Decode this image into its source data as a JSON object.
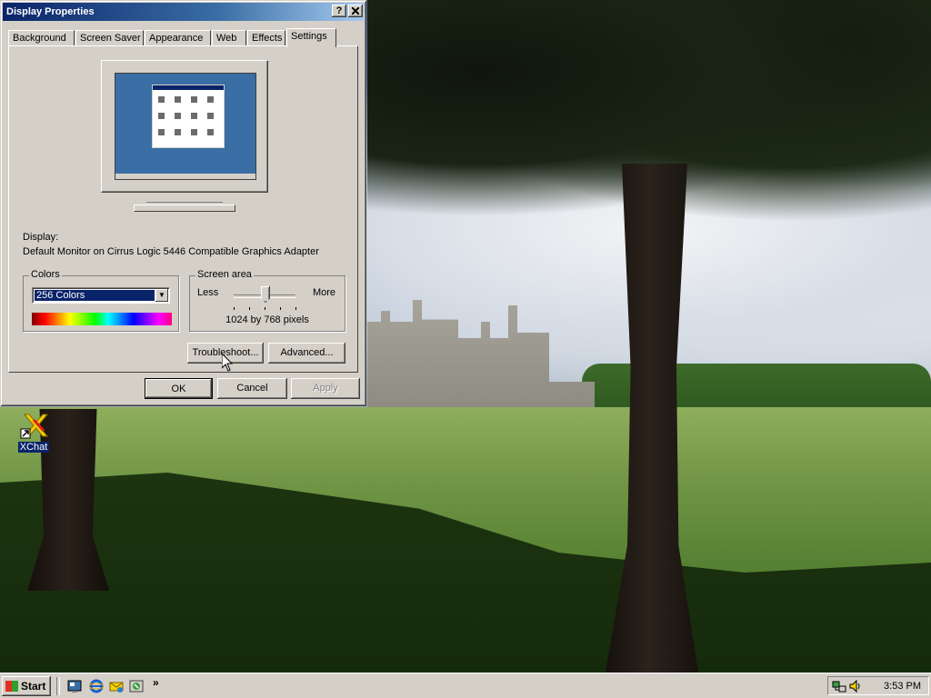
{
  "window": {
    "title": "Display Properties",
    "help_button": "?",
    "close_button": "✕"
  },
  "tabs": [
    {
      "label": "Background"
    },
    {
      "label": "Screen Saver"
    },
    {
      "label": "Appearance"
    },
    {
      "label": "Web"
    },
    {
      "label": "Effects"
    },
    {
      "label": "Settings",
      "active": true
    }
  ],
  "settings": {
    "display_label": "Display:",
    "display_value": "Default Monitor on Cirrus Logic 5446 Compatible Graphics Adapter",
    "colors": {
      "group_label": "Colors",
      "selected": "256 Colors"
    },
    "screen_area": {
      "group_label": "Screen area",
      "less_label": "Less",
      "more_label": "More",
      "resolution": "1024 by 768 pixels"
    },
    "troubleshoot_label": "Troubleshoot...",
    "advanced_label": "Advanced..."
  },
  "buttons": {
    "ok": "OK",
    "cancel": "Cancel",
    "apply": "Apply"
  },
  "desktop": {
    "icons": [
      {
        "label": "XChat",
        "icon": "xchat-icon"
      }
    ]
  },
  "taskbar": {
    "start_label": "Start",
    "quick_launch": [
      "show-desktop-icon",
      "internet-explorer-icon",
      "outlook-express-icon",
      "channels-icon"
    ],
    "more_chevron": "»",
    "clock": "3:53 PM"
  },
  "colors": {
    "titlebar_start": "#0a246a",
    "titlebar_end": "#a6caf0",
    "face": "#d4d0c8",
    "selection": "#0a246a",
    "preview_desktop": "#3a6ea5"
  }
}
